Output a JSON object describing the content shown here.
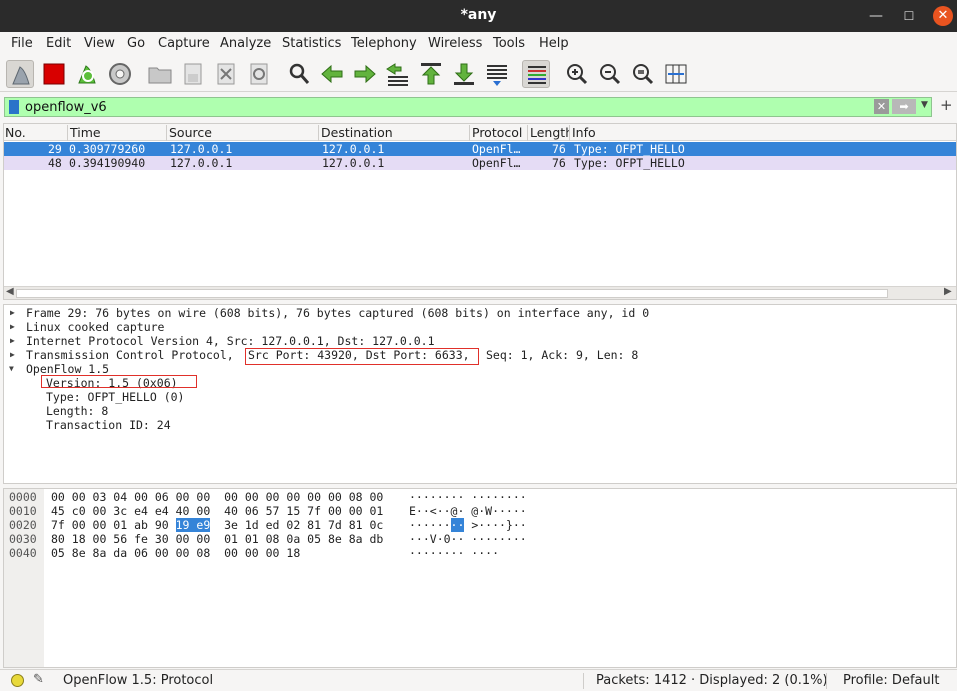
{
  "window": {
    "title": "*any",
    "minimize": "—",
    "maximize": "☐",
    "close": "✕"
  },
  "menu": [
    "File",
    "Edit",
    "View",
    "Go",
    "Capture",
    "Analyze",
    "Statistics",
    "Telephony",
    "Wireless",
    "Tools",
    "Help"
  ],
  "toolbar": {
    "icons": [
      "shark-fin-icon",
      "stop-capture-icon",
      "restart-capture-icon",
      "capture-options-icon",
      "open-file-icon",
      "save-file-icon",
      "close-file-icon",
      "reload-file-icon",
      "find-packet-icon",
      "go-back-icon",
      "go-forward-icon",
      "go-to-packet-icon",
      "first-packet-icon",
      "last-packet-icon",
      "auto-scroll-icon",
      "colorize-icon",
      "zoom-in-icon",
      "zoom-out-icon",
      "normal-size-icon",
      "resize-columns-icon"
    ]
  },
  "filter": {
    "value": "openflow_v6",
    "clear": "✕",
    "apply": "➡",
    "dropdown": "▼",
    "add": "+"
  },
  "packet_list": {
    "columns": [
      "No.",
      "Time",
      "Source",
      "Destination",
      "Protocol",
      "Length",
      "Info"
    ],
    "rows": [
      {
        "no": "29",
        "time": "0.309779260",
        "source": "127.0.0.1",
        "destination": "127.0.0.1",
        "protocol": "OpenFl…",
        "length": "76",
        "info": "Type: OFPT_HELLO"
      },
      {
        "no": "48",
        "time": "0.394190940",
        "source": "127.0.0.1",
        "destination": "127.0.0.1",
        "protocol": "OpenFl…",
        "length": "76",
        "info": "Type: OFPT_HELLO"
      }
    ]
  },
  "details": {
    "frame": "Frame 29: 76 bytes on wire (608 bits), 76 bytes captured (608 bits) on interface any, id 0",
    "linux": "Linux cooked capture",
    "ip": "Internet Protocol Version 4, Src: 127.0.0.1, Dst: 127.0.0.1",
    "tcp_prefix": "Transmission Control Protocol,",
    "tcp_ports": "Src Port: 43920, Dst Port: 6633,",
    "tcp_suffix": "Seq: 1, Ack: 9, Len: 8",
    "openflow": "OpenFlow 1.5",
    "version": "Version: 1.5 (0x06)",
    "type": "Type: OFPT_HELLO (0)",
    "length": "Length: 8",
    "xid": "Transaction ID: 24"
  },
  "hex": {
    "offsets": [
      "0000",
      "0010",
      "0020",
      "0030",
      "0040"
    ],
    "row0": "00 00 03 04 00 06 00 00  00 00 00 00 00 00 08 00",
    "row1": "45 c0 00 3c e4 e4 40 00  40 06 57 15 7f 00 00 01",
    "row2_pre": "7f 00 00 01 ab 90 ",
    "row2_sel": "19 e9",
    "row2_post": "  3e 1d ed 02 81 7d 81 0c",
    "row3": "80 18 00 56 fe 30 00 00  01 01 08 0a 05 8e 8a db",
    "row4": "05 8e 8a da 06 00 00 08  00 00 00 18",
    "ascii0": "········ ········",
    "ascii1": "E··<··@· @·W·····",
    "ascii2_pre": "······",
    "ascii2_sel": "··",
    "ascii2_post": " >····}··",
    "ascii3": "···V·0·· ········",
    "ascii4": "········ ····"
  },
  "status": {
    "field": "OpenFlow 1.5: Protocol",
    "packets": "Packets: 1412 · Displayed: 2 (0.1%)",
    "profile": "Profile: Default"
  }
}
